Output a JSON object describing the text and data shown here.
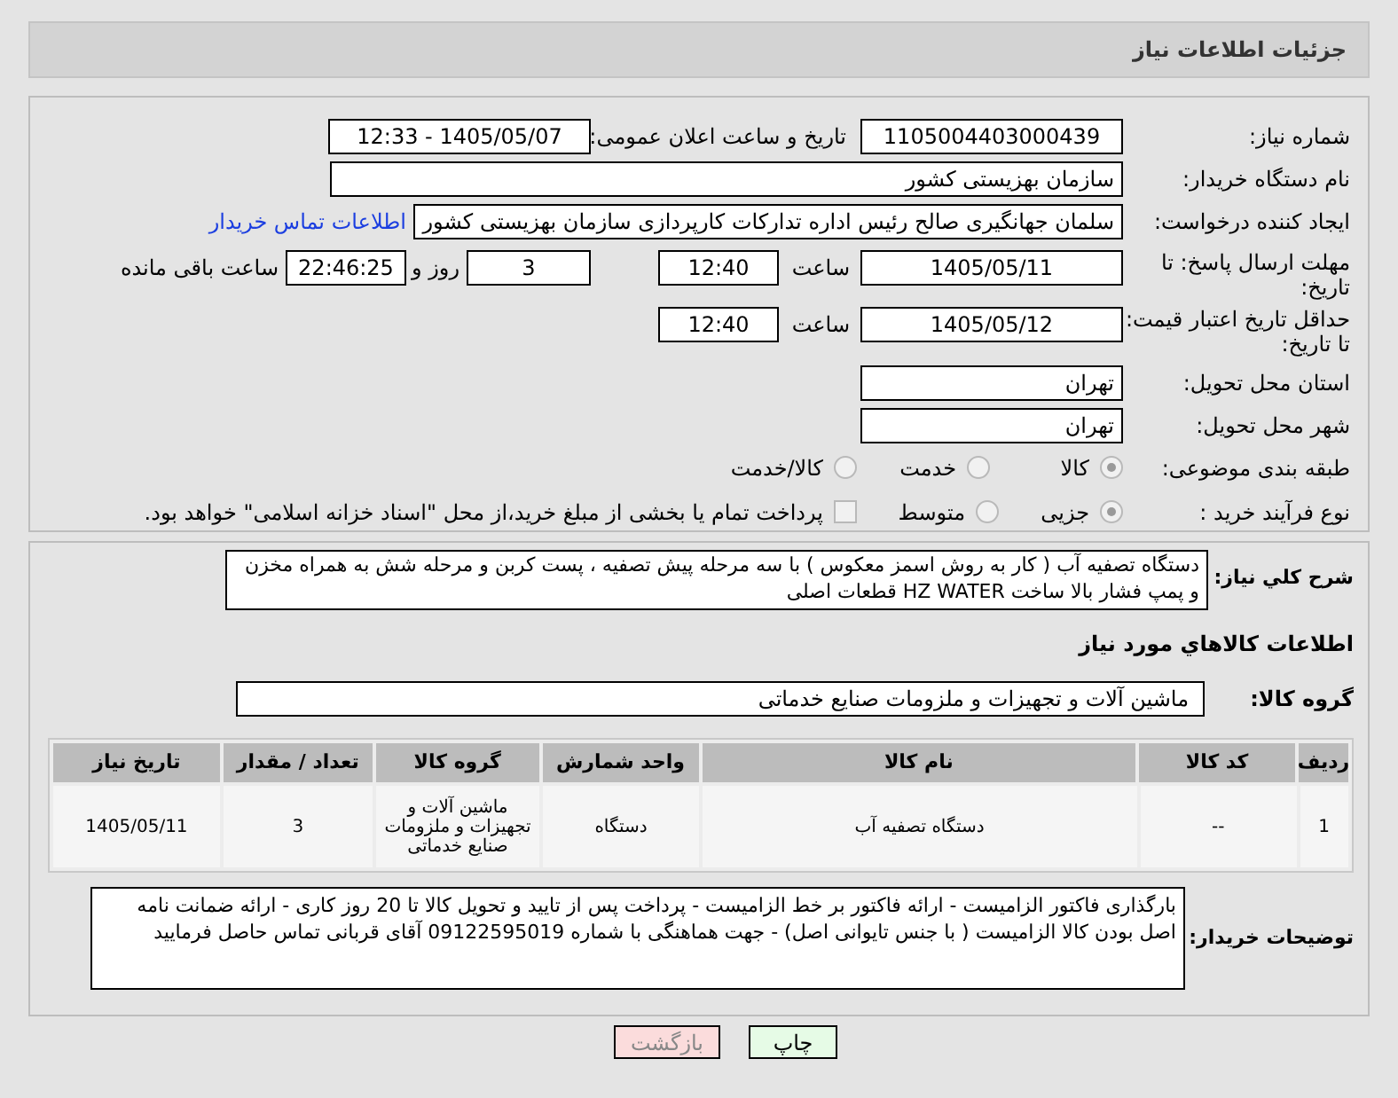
{
  "header": {
    "title": "جزئیات اطلاعات نیاز"
  },
  "fields": {
    "need_number": {
      "label": "شماره نیاز:",
      "value": "1105004403000439"
    },
    "announce": {
      "label": "تاريخ و ساعت اعلان عمومی:",
      "value": "1405/05/07 - 12:33"
    },
    "buyer_org": {
      "label": "نام دستگاه خریدار:",
      "value": "سازمان بهزیستی کشور"
    },
    "creator": {
      "label": "ایجاد کننده درخواست:",
      "value": "سلمان جهانگیری صالح رئیس اداره تدارکات کارپردازی سازمان بهزیستی کشور",
      "link": "اطلاعات تماس خریدار"
    },
    "deadline": {
      "label": "مهلت ارسال پاسخ: تا تاریخ:",
      "date": "1405/05/11",
      "time_label": "ساعت",
      "time": "12:40",
      "days": "3",
      "days_label": "روز و",
      "remaining": "22:46:25",
      "remaining_label": "ساعت باقی مانده"
    },
    "validity": {
      "label": "حداقل تاریخ اعتبار قیمت: تا تاریخ:",
      "date": "1405/05/12",
      "time_label": "ساعت",
      "time": "12:40"
    },
    "province": {
      "label": "استان محل تحویل:",
      "value": "تهران"
    },
    "city": {
      "label": "شهر محل تحویل:",
      "value": "تهران"
    }
  },
  "category": {
    "label": "طبقه بندی موضوعی:",
    "options": [
      {
        "label": "کالا",
        "selected": true
      },
      {
        "label": "خدمت",
        "selected": false
      },
      {
        "label": "کالا/خدمت",
        "selected": false
      }
    ]
  },
  "process": {
    "label": "نوع فرآیند خرید :",
    "options": [
      {
        "label": "جزیی",
        "selected": true
      },
      {
        "label": "متوسط",
        "selected": false
      }
    ],
    "payment": {
      "label": "پرداخت تمام یا بخشی از مبلغ خرید،از محل \"اسناد خزانه اسلامی\" خواهد بود.",
      "checked": false
    }
  },
  "summary": {
    "label": "شرح کلي نياز:",
    "value": "دستگاه تصفیه آب ( کار به روش اسمز معکوس ) با سه مرحله پیش تصفیه ، پست کربن و مرحله شش به همراه مخزن و پمپ فشار بالا ساخت HZ WATER قطعات اصلی"
  },
  "goods": {
    "title": "اطلاعات کالاهاي مورد نياز",
    "group_label": "گروه کالا:",
    "group": "ماشین آلات و تجهیزات و ملزومات صنایع خدماتی",
    "columns": [
      "ردیف",
      "کد کالا",
      "نام کالا",
      "واحد شمارش",
      "گروه کالا",
      "تعداد / مقدار",
      "تاریخ نیاز"
    ],
    "rows": [
      [
        "1",
        "--",
        "دستگاه تصفیه آب",
        "دستگاه",
        "ماشین آلات و تجهیزات و ملزومات صنایع خدماتی",
        "3",
        "1405/05/11"
      ]
    ]
  },
  "notes": {
    "label": "توضیحات خریدار:",
    "value": "بارگذاری فاکتور الزامیست - ارائه فاکتور بر خط الزامیست - پرداخت پس از تایید و تحویل کالا تا 20 روز کاری - ارائه ضمانت نامه اصل بودن کالا الزامیست ( با جنس تایوانی اصل) - جهت هماهنگی با شماره 09122595019 آقای قربانی تماس حاصل فرمایید"
  },
  "buttons": [
    {
      "label": "چاپ",
      "kind": "print"
    },
    {
      "label": "بازگشت",
      "kind": "back"
    }
  ]
}
